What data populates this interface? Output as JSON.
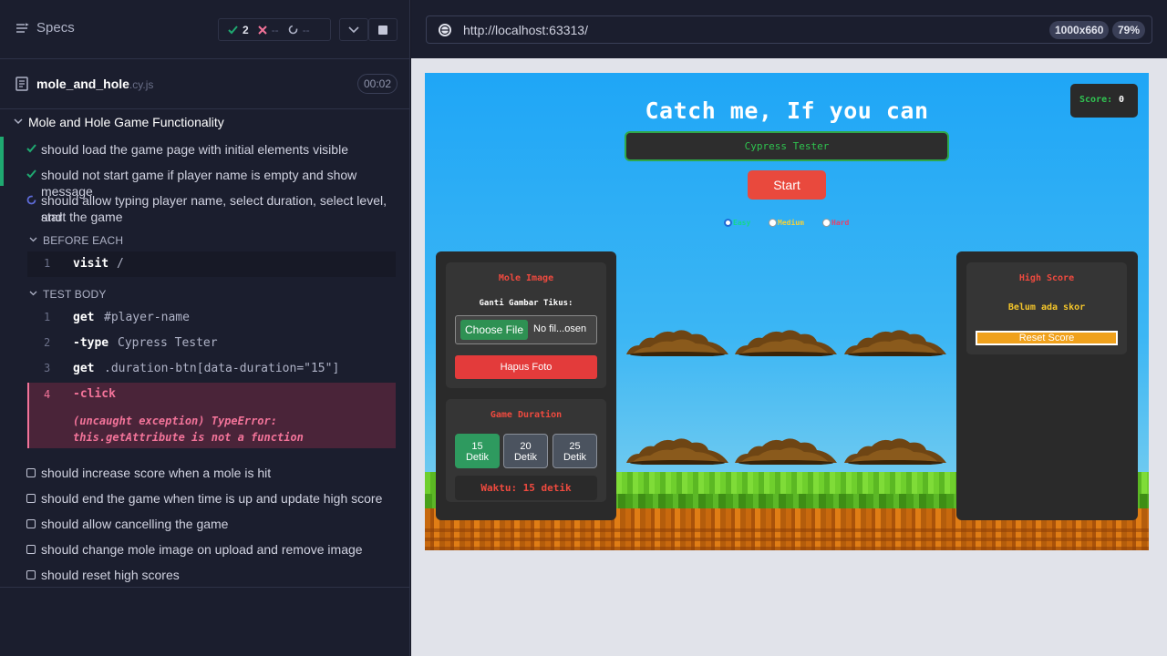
{
  "reporter": {
    "specs_label": "Specs",
    "stats": {
      "passed": "2",
      "failed": "--",
      "pending": "--"
    },
    "file": {
      "name": "mole_and_hole",
      "ext": ".cy.js",
      "duration": "00:02"
    },
    "suite_title": "Mole and Hole Game Functionality",
    "tests_top": [
      {
        "label": "should load the game page with initial elements visible",
        "state": "passed"
      },
      {
        "label": "should not start game if player name is empty and show message",
        "state": "passed"
      },
      {
        "label_line1": "should allow typing player name, select duration, select level, and",
        "label_line2": "start the game",
        "state": "running"
      }
    ],
    "before_each": {
      "header": "BEFORE EACH",
      "commands": [
        {
          "num": "1",
          "name": "visit",
          "arg": "/"
        }
      ]
    },
    "test_body": {
      "header": "TEST BODY",
      "commands": [
        {
          "num": "1",
          "name": "get",
          "arg": "#player-name"
        },
        {
          "num": "2",
          "name": "-type",
          "arg": "Cypress Tester"
        },
        {
          "num": "3",
          "name": "get",
          "arg": ".duration-btn[data-duration=\"15\"]"
        }
      ],
      "error": {
        "num": "4",
        "name": "-click",
        "msg_line1": "(uncaught exception)  TypeError:",
        "msg_line2": "this.getAttribute is not a function"
      }
    },
    "tests_bottom": [
      "should increase score when a mole is hit",
      "should end the game when time is up and update high score",
      "should allow cancelling the game",
      "should change mole image on upload and remove image",
      "should reset high scores"
    ]
  },
  "aut": {
    "url": "http://localhost:63313/",
    "viewport": "1000x660",
    "zoom": "79%"
  },
  "game": {
    "title": "Catch me, If you can",
    "score_label": "Score:",
    "score_value": "0",
    "player_name": "Cypress Tester",
    "start_label": "Start",
    "levels": [
      "Easy",
      "Medium",
      "Hard"
    ],
    "selected_level": "Easy",
    "mole_panel": {
      "title": "Mole Image",
      "subtitle": "Ganti Gambar Tikus:",
      "choose_file": "Choose File",
      "no_file": "No fil...osen",
      "remove": "Hapus Foto"
    },
    "duration_panel": {
      "title": "Game Duration",
      "options": [
        {
          "value": "15",
          "unit": "Detik"
        },
        {
          "value": "20",
          "unit": "Detik"
        },
        {
          "value": "25",
          "unit": "Detik"
        }
      ],
      "selected": "15",
      "timer": "Waktu: 15 detik"
    },
    "high_score_panel": {
      "title": "High Score",
      "empty": "Belum ada skor",
      "reset": "Reset Score"
    }
  },
  "colors": {
    "pass": "#1fa971",
    "fail": "#f27399",
    "sky": "#1fa6f6",
    "accent_red": "#e9493d",
    "accent_green": "#2e9a5f"
  }
}
